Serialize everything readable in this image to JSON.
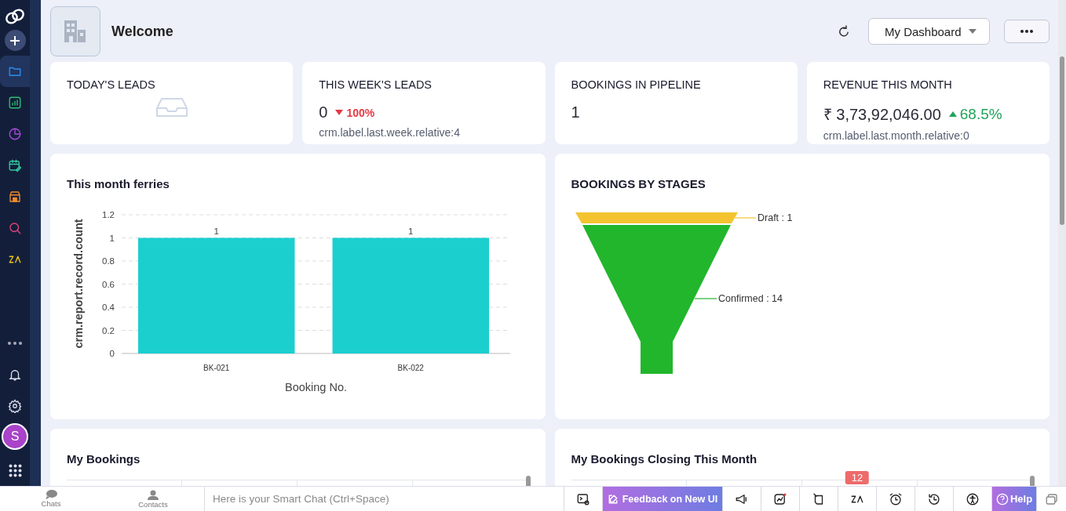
{
  "sidebar": {
    "nav": [
      {
        "kind": "folder",
        "color": "#2b8ef0",
        "selected": true
      },
      {
        "kind": "report",
        "color": "#2fbf71",
        "selected": false
      },
      {
        "kind": "pie",
        "color": "#a64bdb",
        "selected": false
      },
      {
        "kind": "calendar",
        "color": "#35c7a0",
        "selected": false
      },
      {
        "kind": "store",
        "color": "#f28c28",
        "selected": false
      },
      {
        "kind": "search",
        "color": "#e8437a",
        "selected": false
      },
      {
        "kind": "zia",
        "color": "#f0c419",
        "selected": false
      }
    ],
    "avatar": "S"
  },
  "header": {
    "title": "Welcome",
    "dashboard": "My Dashboard"
  },
  "kpis": [
    {
      "kind": "empty",
      "title": "TODAY'S LEADS"
    },
    {
      "kind": "value",
      "title": "THIS WEEK'S LEADS",
      "value": "0",
      "change": "100%",
      "increase": false,
      "note": "crm.label.last.week.relative:4"
    },
    {
      "kind": "value",
      "title": "BOOKINGS IN PIPELINE",
      "value": "1"
    },
    {
      "kind": "value",
      "title": "REVENUE THIS MONTH",
      "value": "₹ 3,73,92,046.00",
      "change": "68.5%",
      "increase": true,
      "note": "crm.label.last.month.relative:0"
    }
  ],
  "ferries": {
    "title": "This month ferries",
    "chart_data": {
      "type": "bar",
      "xlabel": "Booking No.",
      "ylabel": "crm.report.record.count",
      "categories": [
        "BK-021",
        "BK-022"
      ],
      "values": [
        1,
        1
      ],
      "ylim": [
        0,
        1.2
      ],
      "yticks": [
        0,
        0.2,
        0.4,
        0.6,
        0.8,
        1,
        1.2
      ],
      "data_labels": true,
      "grid": true
    }
  },
  "funnel": {
    "title": "BOOKINGS BY STAGES",
    "stages": [
      {
        "label": "Draft : 1",
        "color": "#f4c430"
      },
      {
        "label": "Confirmed : 14",
        "color": "#22b62c"
      }
    ]
  },
  "lists": [
    {
      "title": "My Bookings"
    },
    {
      "title": "My Bookings Closing This Month"
    }
  ],
  "bottom_bar": {
    "chats": "Chats",
    "contacts": "Contacts",
    "placeholder": "Here is your Smart Chat (Ctrl+Space)",
    "tools": [
      {
        "kind": "screen"
      },
      {
        "kind": "feedback",
        "label": "Feedback on New UI"
      },
      {
        "kind": "megaphone"
      },
      {
        "kind": "activity"
      },
      {
        "kind": "note"
      },
      {
        "kind": "zia",
        "badge": "12"
      },
      {
        "kind": "alarm"
      },
      {
        "kind": "history"
      },
      {
        "kind": "accessibility"
      },
      {
        "kind": "help",
        "label": "Help"
      },
      {
        "kind": "stack"
      }
    ]
  }
}
